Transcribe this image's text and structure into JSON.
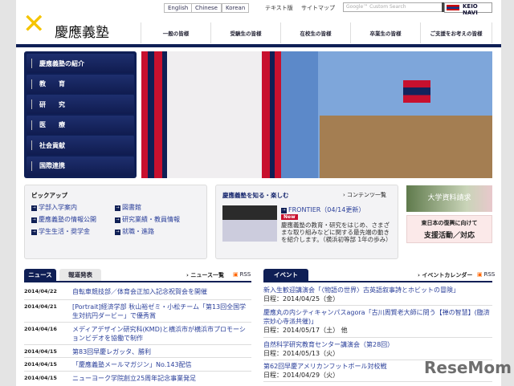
{
  "header": {
    "logo_text": "慶應義塾",
    "languages": [
      "English",
      "Chinese",
      "Korean"
    ],
    "text_version": "テキスト版",
    "sitemap": "サイトマップ",
    "search_placeholder": "Google™ Custom Search",
    "keio_navi": "KEIO NAVI",
    "nav": [
      "一般の皆様",
      "受験生の皆様",
      "在校生の皆様",
      "卒業生の皆様",
      "ご支援をお考えの皆様"
    ]
  },
  "sidebar": [
    "慶應義塾の紹介",
    "教　　育",
    "研　　究",
    "医　　療",
    "社会貢献",
    "国際連携"
  ],
  "pickup": {
    "title": "ピックアップ",
    "links": [
      "学部入学案内",
      "図書館",
      "慶應義塾の情報公開",
      "研究業績・教員情報",
      "学生生活・奨学金",
      "就職・進路"
    ]
  },
  "know": {
    "title": "慶應義塾を知る・楽しむ",
    "more": "コンテンツ一覧",
    "item_title": "FRONTIER（04/14更新）",
    "badge": "New",
    "desc": "慶應義塾の教育・研究をはじめ、さまざまな取り組みなどに関する最先端の動きを紹介します。（横浜初等部 1年の歩み）"
  },
  "banners": [
    "大学資料請求",
    "東日本の復興に向けて",
    "支援活動／対応"
  ],
  "news": {
    "tabs": [
      "ニュース",
      "報道発表"
    ],
    "more": "ニュース一覧",
    "rss": "RSS",
    "items": [
      {
        "date": "2014/04/22",
        "title": "自転車競技部／体育会正加入記念祝賀会を開催"
      },
      {
        "date": "2014/04/21",
        "title": "[Portrait]経済学部 秋山裕ゼミ・小松チーム「第13回全国学生対抗円ダービー」で優秀賞"
      },
      {
        "date": "2014/04/16",
        "title": "メディアデザイン研究科(KMD)と横浜市が横浜市プロモーションビデオを協働で制作"
      },
      {
        "date": "2014/04/15",
        "title": "第83回早慶レガッタ、勝利"
      },
      {
        "date": "2014/04/15",
        "title": "「慶應義塾メールマガジン」No.143配信"
      },
      {
        "date": "2014/04/15",
        "title": "ニューヨーク学院創立25周年記念事業発足"
      }
    ]
  },
  "events": {
    "tab": "イベント",
    "more": "イベントカレンダー",
    "rss": "RSS",
    "items": [
      {
        "title": "新入生歓迎講演会「〈物語の世界〉古英語叙事詩とホビットの冒険」",
        "date": "日程：2014/04/25（金）"
      },
      {
        "title": "慶應丸の内シティキャンパスagora「古川周賢老大師に問う【禅の智慧】(臨済宗妙心寺派共催)」",
        "date": "日程：2014/05/17（土） 他"
      },
      {
        "title": "自然科学研究教育センター講演会（第28回）",
        "date": "日程：2014/05/13（火）"
      },
      {
        "title": "第62回早慶アメリカンフットボール対校戦",
        "date": "日程：2014/04/29（火）"
      }
    ]
  },
  "watermark": "ReseMom"
}
